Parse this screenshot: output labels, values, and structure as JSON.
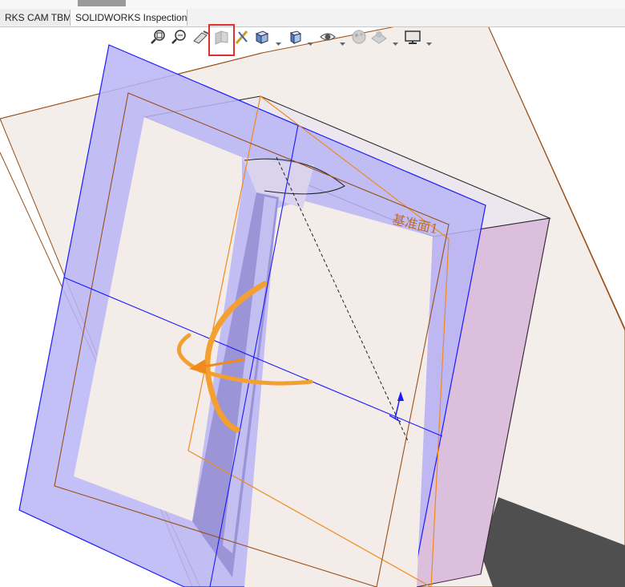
{
  "tabs": [
    {
      "label": "RKS CAM TBM"
    },
    {
      "label": "SOLIDWORKS Inspection"
    }
  ],
  "heads_up_toolbar": {
    "buttons": [
      {
        "icon": "zoom-to-fit-icon"
      },
      {
        "icon": "zoom-to-area-icon"
      },
      {
        "icon": "previous-view-icon"
      },
      {
        "icon": "section-view-icon",
        "highlighted": true
      },
      {
        "icon": "dynamic-annotation-views-icon"
      },
      {
        "icon": "view-orientation-icon"
      },
      {
        "icon": "display-style-icon"
      },
      {
        "icon": "hide-show-items-icon"
      },
      {
        "icon": "edit-appearance-icon"
      },
      {
        "icon": "apply-scene-icon"
      },
      {
        "icon": "view-settings-icon"
      }
    ],
    "highlight_color": "#e0302c"
  },
  "viewport": {
    "plane_label": "基准面1",
    "colors": {
      "plane_edge": "#1a1aff",
      "plane_fill": "#a9a6f2",
      "sketch_line": "#f08a1c",
      "rotation_handle": "#f4a030",
      "body_edge": "#9a4f18",
      "shadow": "#4a4a4a"
    }
  }
}
